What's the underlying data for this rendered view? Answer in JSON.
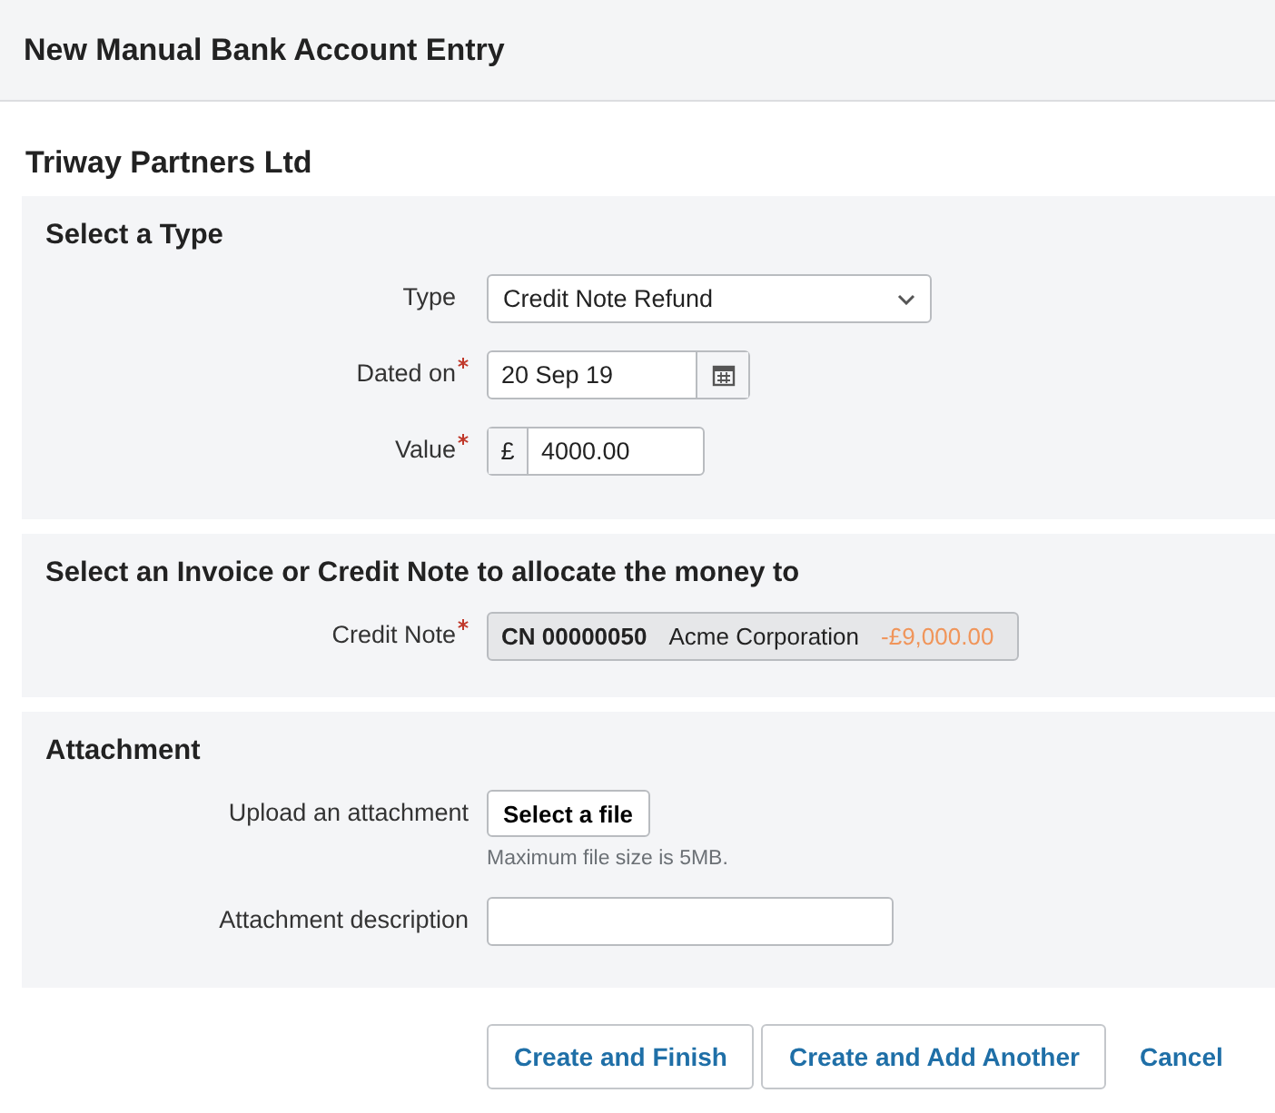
{
  "header": {
    "title": "New Manual Bank Account Entry"
  },
  "company": "Triway Partners Ltd",
  "type_section": {
    "title": "Select a Type",
    "fields": [
      {
        "kind": "select",
        "label": "Type",
        "required": false,
        "value": "Credit Note Refund"
      },
      {
        "kind": "date",
        "label": "Dated on",
        "required": true,
        "value": "20 Sep 19"
      },
      {
        "kind": "money",
        "label": "Value",
        "required": true,
        "currency": "£",
        "value": "4000.00"
      }
    ]
  },
  "allocate_section": {
    "title": "Select an Invoice or Credit Note to allocate the money to",
    "label": "Credit Note",
    "required": true,
    "number": "CN 00000050",
    "customer": "Acme Corporation",
    "amount": "-£9,000.00"
  },
  "attachment_section": {
    "title": "Attachment",
    "upload_label": "Upload an attachment",
    "upload_button": "Select a file",
    "hint": "Maximum file size is 5MB.",
    "description_label": "Attachment description"
  },
  "buttons": [
    {
      "kind": "button",
      "label": "Create and Finish"
    },
    {
      "kind": "button",
      "label": "Create and Add Another"
    },
    {
      "kind": "link",
      "label": "Cancel"
    }
  ]
}
